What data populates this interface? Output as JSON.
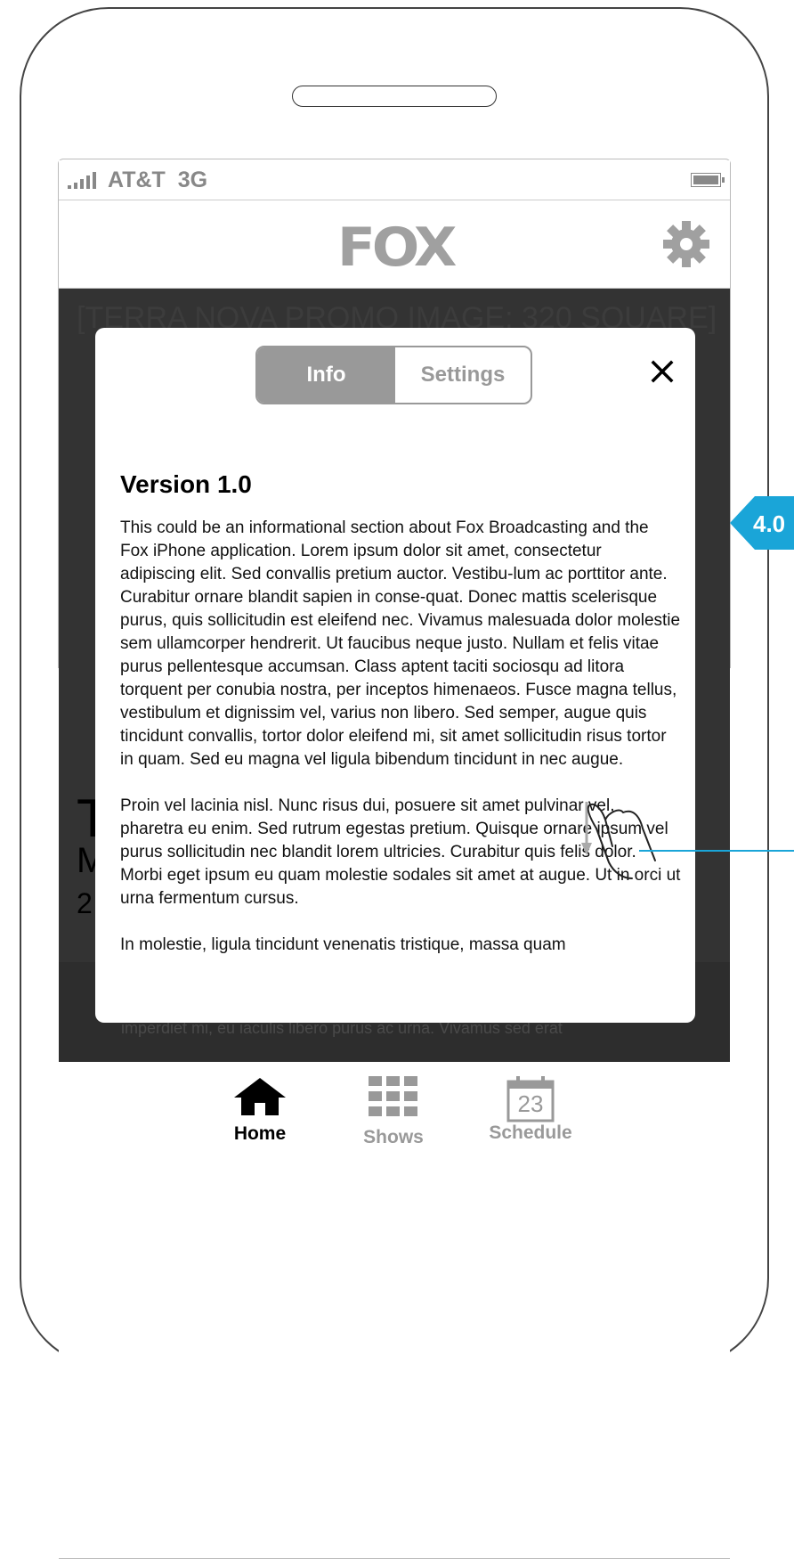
{
  "status": {
    "carrier": "AT&T",
    "network": "3G"
  },
  "nav": {
    "logo": "FOX"
  },
  "background": {
    "promo": "[TERRA NOVA PROMO IMAGE: 320 SQUARE]",
    "show_title_initial": "T",
    "show_sub_initial": "M",
    "show_date_initial": "2",
    "bleed_text": "imperdiet mi, eu iaculis libero purus ac urna. Vivamus sed erat"
  },
  "modal": {
    "tabs": [
      {
        "label": "Info",
        "selected": true
      },
      {
        "label": "Settings",
        "selected": false
      }
    ],
    "title": "Version 1.0",
    "paragraphs": [
      "This could be an informational section about Fox Broadcasting and the Fox iPhone application.  Lorem ipsum dolor sit amet, consectetur adipiscing elit. Sed convallis pretium auctor. Vestibu-lum ac porttitor ante. Curabitur ornare blandit sapien in conse-quat. Donec mattis scelerisque purus, quis sollicitudin est eleifend nec. Vivamus malesuada dolor molestie sem ullamcorper hendrerit. Ut faucibus neque justo. Nullam et felis vitae purus pellentesque accumsan. Class aptent taciti sociosqu ad litora torquent per conubia nostra, per inceptos himenaeos. Fusce magna tellus, vestibulum et dignissim vel, varius non libero. Sed semper, augue quis tincidunt convallis, tortor dolor eleifend mi, sit amet sollicitudin risus tortor in quam. Sed eu magna vel ligula bibendum tincidunt in nec augue.",
      "Proin vel lacinia nisl. Nunc risus dui, posuere sit amet pulvinar vel, pharetra eu enim. Sed rutrum egestas pretium. Quisque ornare ipsum vel purus sollicitudin nec blandit lorem ultricies. Curabitur quis felis dolor. Morbi eget ipsum eu quam molestie sodales sit amet at augue. Ut in orci ut urna fermentum cursus.",
      "In molestie, ligula tincidunt venenatis tristique, massa quam"
    ]
  },
  "tabbar": {
    "items": [
      {
        "label": "Home",
        "icon": "home-icon",
        "active": true
      },
      {
        "label": "Shows",
        "icon": "grid-icon",
        "active": false
      },
      {
        "label": "Schedule",
        "icon": "calendar-icon",
        "active": false,
        "badge": "23"
      }
    ]
  },
  "annotation": {
    "label": "4.0"
  },
  "colors": {
    "accent": "#1aa5d8",
    "active": "#000000",
    "inactive": "#999999",
    "dark": "#333333"
  }
}
